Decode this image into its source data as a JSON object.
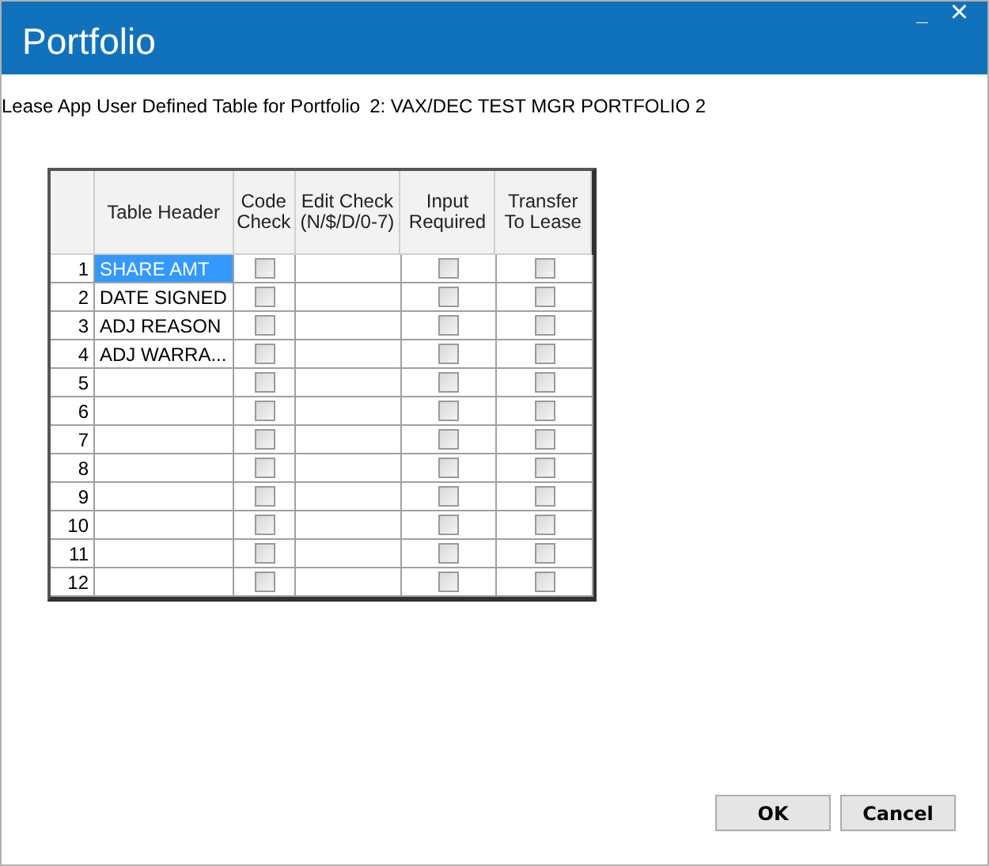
{
  "window": {
    "title": "Portfolio",
    "controls": [
      {
        "kind": "minimize",
        "label": "_"
      },
      {
        "kind": "close",
        "label": "×"
      }
    ]
  },
  "subtitle": {
    "label": "Lease App User Defined Table for Portfolio",
    "value": "2: VAX/DEC TEST MGR PORTFOLIO 2"
  },
  "table": {
    "columns": [
      "Table Header",
      "Code Check",
      "Edit Check (N/$/D/0-7)",
      "Input Required",
      "Transfer To Lease"
    ],
    "rows": [
      {
        "number": "1",
        "header": "SHARE AMT",
        "selected": true,
        "code_check": false,
        "input_required": false,
        "transfer_to_lease": false
      },
      {
        "number": "2",
        "header": "DATE SIGNED",
        "selected": false,
        "code_check": false,
        "input_required": false,
        "transfer_to_lease": false
      },
      {
        "number": "3",
        "header": "ADJ REASON",
        "selected": false,
        "code_check": false,
        "input_required": false,
        "transfer_to_lease": false
      },
      {
        "number": "4",
        "header": "ADJ WARRA...",
        "selected": false,
        "code_check": false,
        "input_required": false,
        "transfer_to_lease": false
      },
      {
        "number": "5",
        "selected": false,
        "code_check": false,
        "input_required": false,
        "transfer_to_lease": false
      },
      {
        "number": "6",
        "selected": false,
        "code_check": false,
        "input_required": false,
        "transfer_to_lease": false
      },
      {
        "number": "7",
        "selected": false,
        "code_check": false,
        "input_required": false,
        "transfer_to_lease": false
      },
      {
        "number": "8",
        "selected": false,
        "code_check": false,
        "input_required": false,
        "transfer_to_lease": false
      },
      {
        "number": "9",
        "selected": false,
        "code_check": false,
        "input_required": false,
        "transfer_to_lease": false
      },
      {
        "number": "10",
        "selected": false,
        "code_check": false,
        "input_required": false,
        "transfer_to_lease": false
      },
      {
        "number": "11",
        "selected": false,
        "code_check": false,
        "input_required": false,
        "transfer_to_lease": false
      },
      {
        "number": "12",
        "selected": false,
        "code_check": false,
        "input_required": false,
        "transfer_to_lease": false
      }
    ]
  },
  "buttons": [
    "OK",
    "Cancel"
  ]
}
